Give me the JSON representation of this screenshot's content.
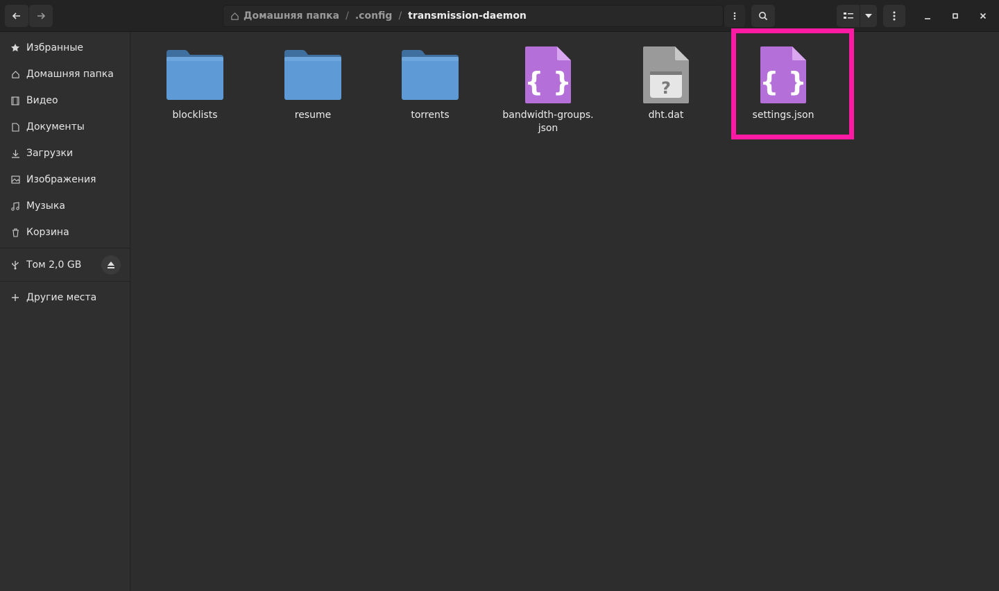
{
  "header": {
    "breadcrumbs": [
      {
        "label": "Домашняя папка"
      },
      {
        "label": ".config"
      },
      {
        "label": "transmission-daemon"
      }
    ],
    "separator": "/"
  },
  "sidebar": {
    "items": [
      {
        "label": "Избранные",
        "icon": "star-icon"
      },
      {
        "label": "Домашняя папка",
        "icon": "home-icon"
      },
      {
        "label": "Видео",
        "icon": "video-icon"
      },
      {
        "label": "Документы",
        "icon": "document-icon"
      },
      {
        "label": "Загрузки",
        "icon": "download-icon"
      },
      {
        "label": "Изображения",
        "icon": "image-icon"
      },
      {
        "label": "Музыка",
        "icon": "music-icon"
      },
      {
        "label": "Корзина",
        "icon": "trash-icon"
      }
    ],
    "volume": {
      "label": "Том 2,0 GB",
      "icon": "usb-icon"
    },
    "other": {
      "label": "Другие места",
      "icon": "plus-icon"
    }
  },
  "files": [
    {
      "name": "blocklists",
      "type": "folder"
    },
    {
      "name": "resume",
      "type": "folder"
    },
    {
      "name": "torrents",
      "type": "folder"
    },
    {
      "name": "bandwidth-groups.\njson",
      "type": "json"
    },
    {
      "name": "dht.dat",
      "type": "unknown"
    },
    {
      "name": "settings.json",
      "type": "json",
      "highlighted": true
    }
  ],
  "colors": {
    "highlight": "#ff1aa3",
    "folder": "#5e9bd6",
    "json": "#b46fd9",
    "unknown": "#9a9a9a"
  }
}
